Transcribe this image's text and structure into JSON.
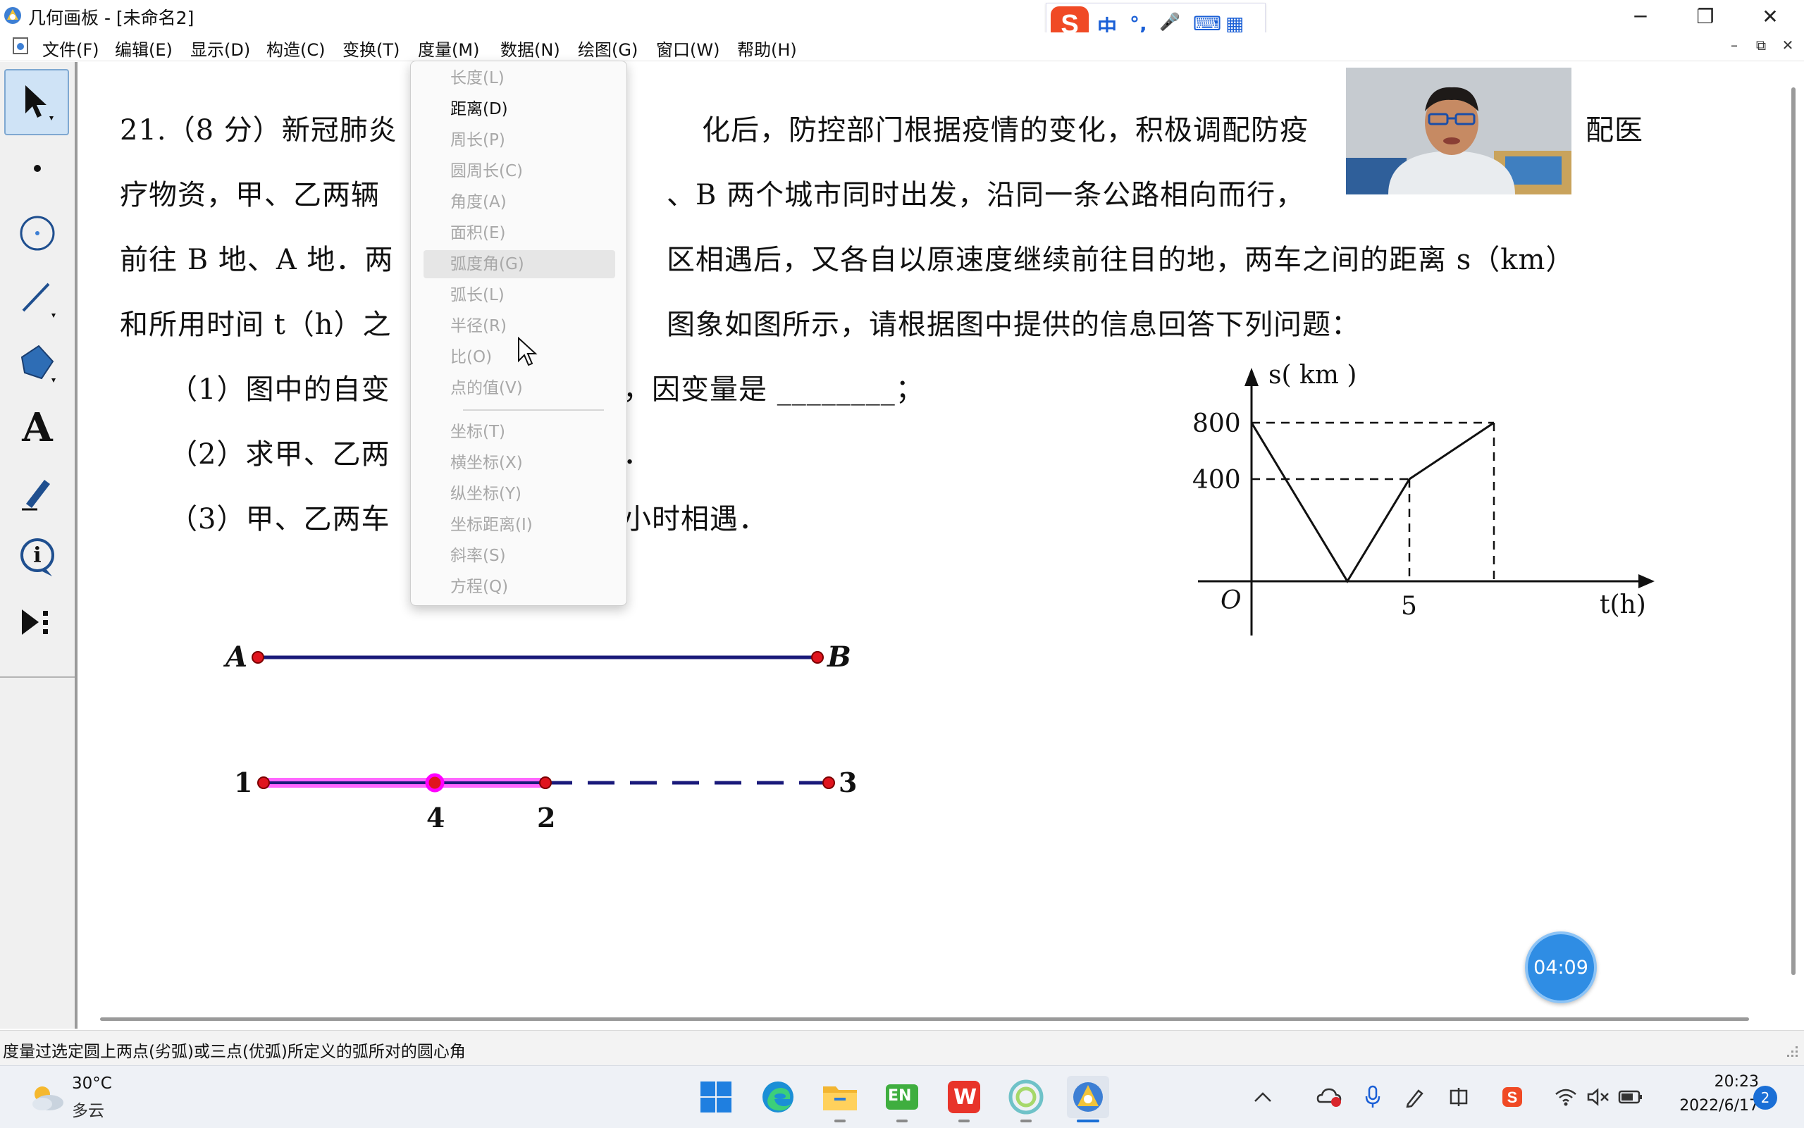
{
  "window": {
    "title": "几何画板 - [未命名2]",
    "controls": {
      "minimize": "─",
      "maximize": "❐",
      "close": "✕"
    }
  },
  "ime": {
    "mode": "中",
    "punct": "°,",
    "mic": "🎤",
    "keyboard": "⌨",
    "apps": "▦"
  },
  "menubar": {
    "items": [
      "文件(F)",
      "编辑(E)",
      "显示(D)",
      "构造(C)",
      "变换(T)",
      "度量(M)",
      "数据(N)",
      "绘图(G)",
      "窗口(W)",
      "帮助(H)"
    ],
    "mdi": {
      "minimize": "–",
      "restore": "⧉",
      "close": "✕"
    }
  },
  "toolbox": {
    "tools": [
      "arrow-select-icon",
      "point-icon",
      "compass-icon",
      "straightedge-icon",
      "polygon-icon",
      "text-icon",
      "marker-icon",
      "information-icon",
      "custom-tool-icon"
    ],
    "text_tool_label": "A",
    "info_label": "i"
  },
  "question": {
    "line1a": "21.（8 分）新冠肺炎",
    "line1b": "化后，防控部门根据疫情的变化，积极调配防疫",
    "line1c": "配医",
    "line2a": "疗物资，甲、乙两辆",
    "line2b": "、B 两个城市同时出发，沿同一条公路相向而行，",
    "line3a": "前往 B 地、A 地．两",
    "line3b": "区相遇后，又各自以原速度继续前往目的地，两车之间的距离 s（km）",
    "line4a": "和所用时间 t（h）之",
    "line4b": "图象如图所示，请根据图中提供的信息回答下列问题：",
    "q1a": "（1）图中的自变",
    "q1b": "，因变量是 ________；",
    "q2a": "（2）求甲、乙两",
    "q2b": "．",
    "q3a": "（3）甲、乙两车",
    "q3b": "小时相遇．"
  },
  "graph": {
    "ylabel": "s( km )",
    "xlabel": "t(h)",
    "origin": "O",
    "yticks": [
      "800",
      "400"
    ],
    "xticks": [
      "5"
    ]
  },
  "geometry": {
    "point_a": "A",
    "point_b": "B",
    "p1": "1",
    "p2": "2",
    "p3": "3",
    "p4": "4",
    "colors": {
      "segment": "#1a1a7a",
      "point": "#e0141e",
      "selected": "#ff00ff"
    }
  },
  "measure_menu": {
    "items": [
      {
        "label": "长度(L)",
        "enabled": false
      },
      {
        "label": "距离(D)",
        "enabled": true
      },
      {
        "label": "周长(P)",
        "enabled": false
      },
      {
        "label": "圆周长(C)",
        "enabled": false
      },
      {
        "label": "角度(A)",
        "enabled": false
      },
      {
        "label": "面积(E)",
        "enabled": false
      },
      {
        "label": "弧度角(G)",
        "enabled": false,
        "hover": true
      },
      {
        "label": "弧长(L)",
        "enabled": false
      },
      {
        "label": "半径(R)",
        "enabled": false
      },
      {
        "label": "比(O)",
        "enabled": false
      },
      {
        "label": "点的值(V)",
        "enabled": false
      },
      {
        "label": "坐标(T)",
        "enabled": false
      },
      {
        "label": "横坐标(X)",
        "enabled": false
      },
      {
        "label": "纵坐标(Y)",
        "enabled": false
      },
      {
        "label": "坐标距离(I)",
        "enabled": false
      },
      {
        "label": "斜率(S)",
        "enabled": false
      },
      {
        "label": "方程(Q)",
        "enabled": false
      }
    ]
  },
  "status_bar": {
    "text": "度量过选定圆上两点(劣弧)或三点(优弧)所定义的弧所对的圆心角"
  },
  "timer": {
    "text": "04:09"
  },
  "taskbar": {
    "weather_temp": "30°C",
    "weather_desc": "多云",
    "clock_time": "20:23",
    "clock_date": "2022/6/17",
    "notifications": "2",
    "apps": [
      "windows-start-icon",
      "edge-icon",
      "file-explorer-icon",
      "en-app-icon",
      "wps-icon",
      "photos-icon",
      "geometer-sketchpad-icon"
    ],
    "en_label": "EN",
    "wps_label": "W"
  }
}
